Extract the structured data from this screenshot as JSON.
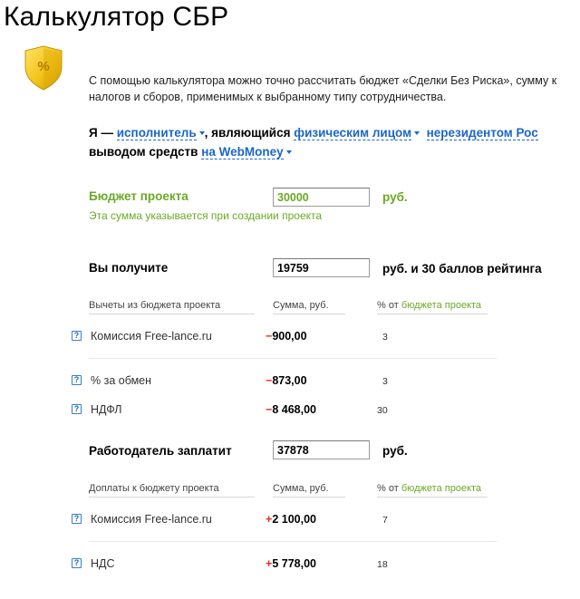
{
  "page": {
    "title": "Калькулятор СБР",
    "intro_line1": "С помощью калькулятора можно точно рассчитать бюджет «Сделки Без Риска», сумму к",
    "intro_line2": "налогов и сборов, применимых к выбранному типу сотрудничества."
  },
  "sentence": {
    "prefix": "Я —",
    "role": "исполнитель",
    "mid": ", являющийся",
    "person_type": "физическим лицом",
    "residency": "нерезидентом Рос",
    "withdraw_label": "выводом средств",
    "withdraw_method": "на WebMoney"
  },
  "budget": {
    "label": "Бюджет проекта",
    "value": "30000",
    "unit": "руб.",
    "hint": "Эта сумма указывается при создании проекта"
  },
  "receive": {
    "label": "Вы получите",
    "value": "19759",
    "unit": "руб. и 30 баллов рейтинга"
  },
  "deductions": {
    "col1": "Вычеты из бюджета проекта",
    "col2": "Сумма, руб.",
    "col3_prefix": "% от",
    "col3_link": "бюджета проекта",
    "rows": [
      {
        "name": "Комиссия Free-lance.ru",
        "sign": "−",
        "amount": "900,00",
        "pct": "3"
      },
      {
        "name": "% за обмен",
        "sign": "−",
        "amount": "873,00",
        "pct": "3"
      },
      {
        "name": "НДФЛ",
        "sign": "−",
        "amount": "8 468,00",
        "pct": "30"
      }
    ]
  },
  "employer": {
    "label": "Работодатель заплатит",
    "value": "37878",
    "unit": "руб."
  },
  "additions": {
    "col1": "Доплаты к бюджету проекта",
    "col2": "Сумма, руб.",
    "col3_prefix": "% от",
    "col3_link": "бюджета проекта",
    "rows": [
      {
        "name": "Комиссия Free-lance.ru",
        "sign": "+",
        "amount": "2 100,00",
        "pct": "7"
      },
      {
        "name": "НДС",
        "sign": "+",
        "amount": "5 778,00",
        "pct": "18"
      }
    ]
  },
  "icons": {
    "shield": "shield-percent-icon",
    "help": "help-icon"
  },
  "colors": {
    "link": "#1b66c9",
    "green": "#6aa926",
    "red": "#e0301e",
    "shield_gold": "#f2c31a"
  }
}
